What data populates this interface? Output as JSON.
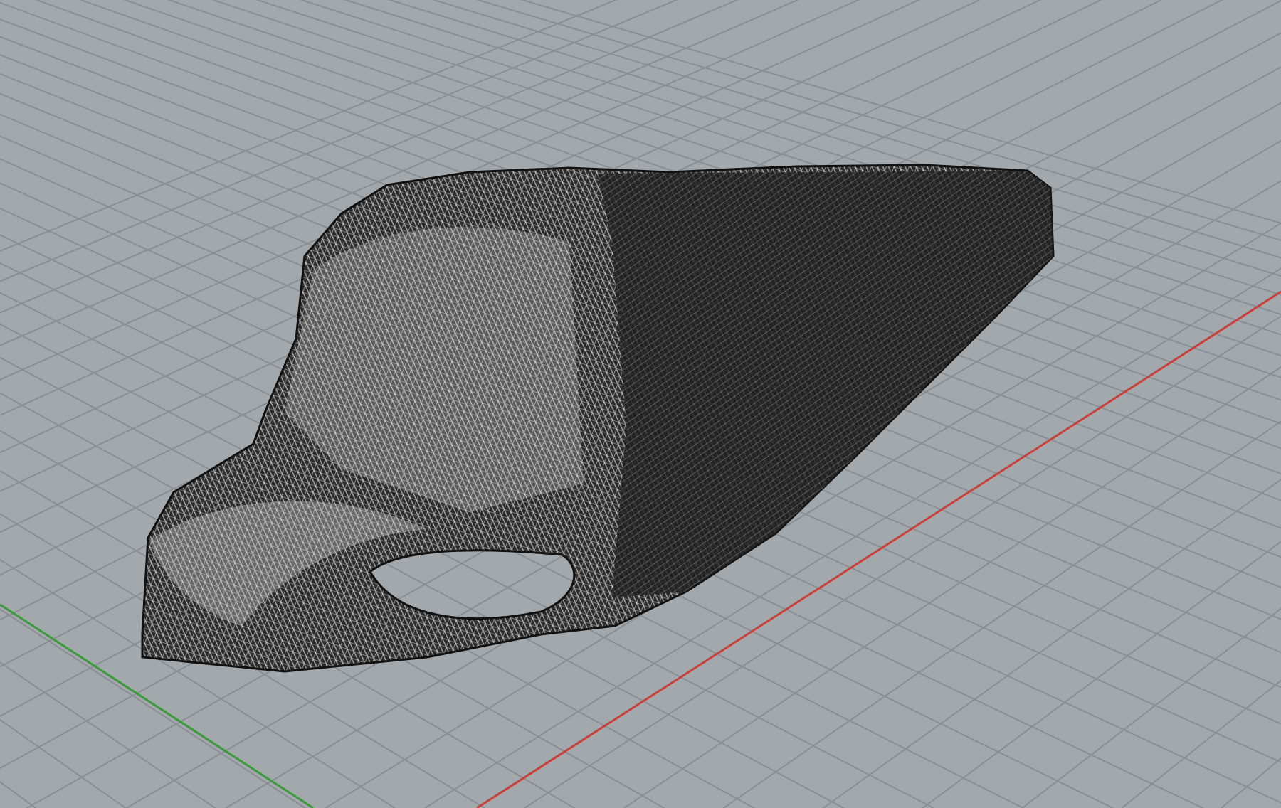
{
  "viewport": {
    "axes": [
      {
        "kind": "x",
        "color": "#c8403a"
      },
      {
        "kind": "y",
        "color": "#3c9a3c"
      }
    ]
  }
}
